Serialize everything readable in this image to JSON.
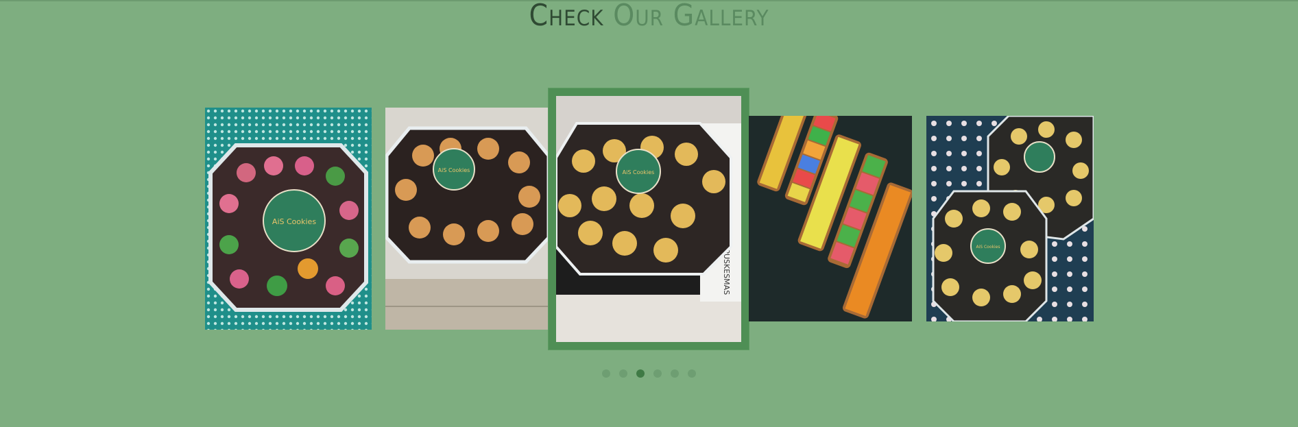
{
  "section": {
    "title_part1": "Check",
    "title_part2": "Our Gallery"
  },
  "gallery": {
    "images": [
      {
        "subject": "Assorted colorful cookies in octagonal box",
        "logo_text": "AiS Cookies"
      },
      {
        "subject": "Cookies in clear octagonal container on table",
        "logo_text": "AiS Cookies"
      },
      {
        "subject": "Golden round cookies in octagonal box",
        "logo_text": "AiS Cookies",
        "side_text": "UPTD PUSKESMAS"
      },
      {
        "subject": "Colorful cookie trays on dark table",
        "logo_text": ""
      },
      {
        "subject": "Two boxes of golden cookies on polka dot cloth",
        "logo_text": "AiS Cookies"
      }
    ],
    "active_index": 2,
    "dot_count": 6,
    "active_dot": 2
  },
  "colors": {
    "background": "#7eae80",
    "accent": "#4f8f55",
    "dot": "#6e9e72",
    "dot_active": "#3f7a45"
  }
}
